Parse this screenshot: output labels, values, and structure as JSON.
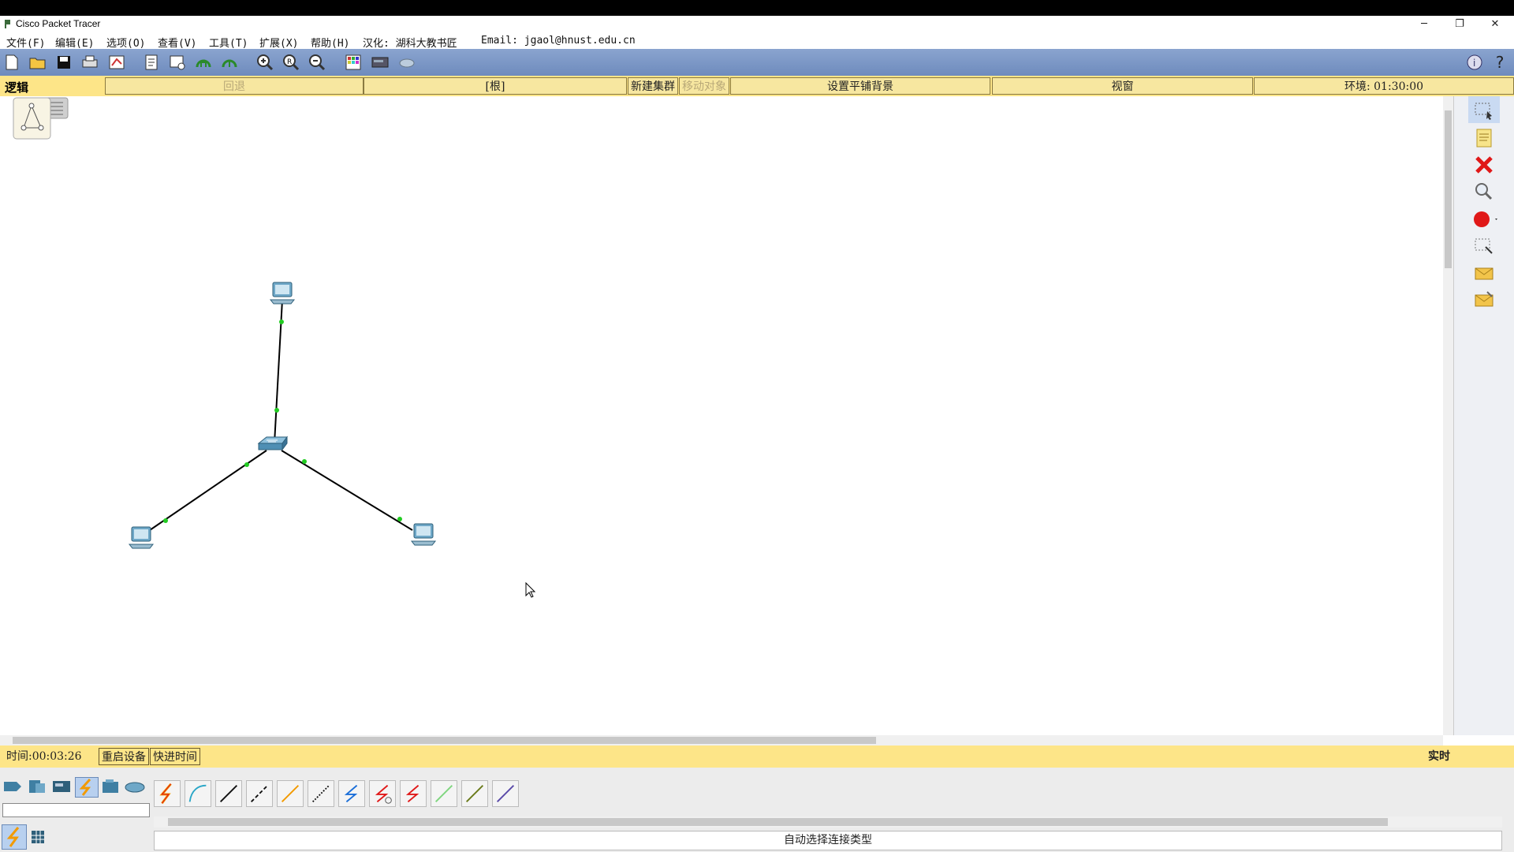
{
  "window": {
    "title": "Cisco Packet Tracer",
    "minimize": "─",
    "restore": "❐",
    "close": "✕"
  },
  "menu": [
    {
      "label": "文件(F)"
    },
    {
      "label": "编辑(E)"
    },
    {
      "label": "选项(O)"
    },
    {
      "label": "查看(V)"
    },
    {
      "label": "工具(T)"
    },
    {
      "label": "扩展(X)"
    },
    {
      "label": "帮助(H)"
    },
    {
      "label": "汉化: 湖科大教书匠"
    },
    {
      "label": "Email: jgaol@hnust.edu.cn"
    }
  ],
  "toolbar": {
    "icons": [
      "new-file-icon",
      "open-folder-icon",
      "save-icon",
      "print-icon",
      "activity-wizard-icon",
      "inspect-icon",
      "pdu-icon",
      "custom-icon-1",
      "custom-icon-2",
      "zoom-in-icon",
      "zoom-reset-icon",
      "zoom-out-icon",
      "palette-icon",
      "device-template-icon",
      "cloud-icon"
    ],
    "help_info": "i",
    "help": "?"
  },
  "navbar": {
    "mode_label": "逻辑",
    "back": "回退",
    "root": "[根]",
    "new_cluster": "新建集群",
    "move_object": "移动对象",
    "set_tiled_background": "设置平铺背景",
    "viewport": "视窗",
    "environment": "环境: 01:30:00"
  },
  "topology": {
    "devices": [
      {
        "name": "pc-top"
      },
      {
        "name": "switch"
      },
      {
        "name": "pc-left"
      },
      {
        "name": "pc-right"
      }
    ],
    "link_color": "#000000",
    "port_status_color": "#22cc22"
  },
  "statusbar": {
    "time": "时间:00:03:26",
    "reboot_devices": "重启设备",
    "fast_forward": "快进时间",
    "realtime": "实时"
  },
  "devices_panel": {
    "hint": "自动选择连接类型",
    "search_value": ""
  }
}
